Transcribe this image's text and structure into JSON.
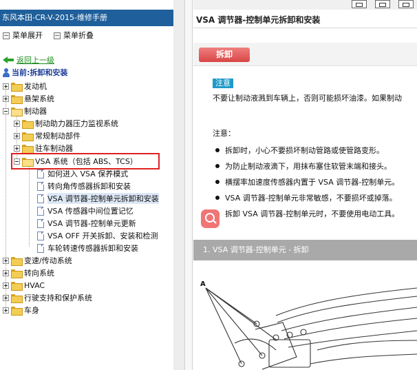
{
  "left_pane": {
    "title": "东风本田-CR-V-2015-维修手册",
    "toolbar": {
      "expand_label": "菜单展开",
      "collapse_label": "菜单折叠"
    },
    "back_label": "返回上一级",
    "current_label": "当前:拆卸和安装",
    "tree": [
      {
        "label": "发动机"
      },
      {
        "label": "悬架系统"
      },
      {
        "label": "制动器"
      },
      {
        "label": "制动助力器压力监视系统"
      },
      {
        "label": "常规制动部件"
      },
      {
        "label": "驻车制动器"
      },
      {
        "label": "VSA 系统（包括 ABS、TCS）"
      },
      {
        "label": "如何进入 VSA 保养模式"
      },
      {
        "label": "转向角传感器拆卸和安装"
      },
      {
        "label": "VSA 调节器-控制单元拆卸和安装"
      },
      {
        "label": "VSA 传感器中间位置记忆"
      },
      {
        "label": "VSA 调节器-控制单元更新"
      },
      {
        "label": "VSA OFF 开关拆卸、安装和检测"
      },
      {
        "label": "车轮转速传感器拆卸和安装"
      },
      {
        "label": "变速/传动系统"
      },
      {
        "label": "转向系统"
      },
      {
        "label": "HVAC"
      },
      {
        "label": "行驶支持和保护系统"
      },
      {
        "label": "车身"
      }
    ]
  },
  "right_pane": {
    "page_title": "VSA 调节器-控制单元拆卸和安装",
    "remove_button": "拆卸",
    "note_badge": "注意",
    "note_text": "不要让制动液溅到车辆上，否则可能损坏油漆。如果制动",
    "notes_heading": "注意：",
    "bullets": [
      "拆卸时，小心不要损坏制动管路或使管路变形。",
      "为防止制动液滴下，用抹布塞住软管末端和接头。",
      "横摆率加速度传感器内置于 VSA 调节器-控制单元。",
      "VSA 调节器-控制单元非常敏感，不要损坏或掉落。",
      "拆卸 VSA 调节器-控制单元时，不要使用电动工具。"
    ],
    "section_title": "1. VSA 调节器-控制单元 - 拆卸",
    "figure_label": "A"
  },
  "colors": {
    "title_bar": "#1f5f9b",
    "highlight_box": "#e02020",
    "remove_button": "#e46262",
    "note_badge": "#1e9ac9",
    "section_bar": "#a9a9a9"
  },
  "icons": [
    "menu-expand-icon",
    "menu-collapse-icon",
    "back-arrow-icon",
    "current-location-icon",
    "folder-icon",
    "document-icon",
    "zoom-icon"
  ]
}
